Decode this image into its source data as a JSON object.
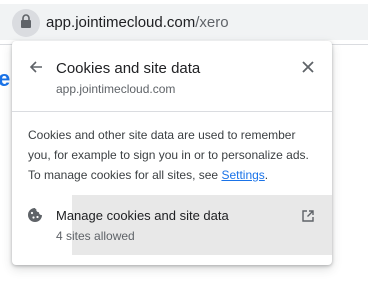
{
  "address_bar": {
    "url_host": "app.jointimecloud.com",
    "url_path": "/xero",
    "lock_icon": "lock-icon"
  },
  "background_page": {
    "partial_text": "e"
  },
  "popup": {
    "title": "Cookies and site data",
    "subtitle": "app.jointimecloud.com",
    "back_icon": "arrow-back-icon",
    "close_icon": "close-icon",
    "description_text": "Cookies and other site data are used to remember you, for example to sign you in or to personalize ads. To manage cookies for all sites, see ",
    "description_link": "Settings",
    "description_end": ".",
    "manage": {
      "label": "Manage cookies and site data",
      "count": "4 sites allowed",
      "icon": "cookie-icon",
      "external_icon": "open-in-new-icon"
    }
  },
  "colors": {
    "link": "#1a73e8",
    "text_primary": "#202124",
    "text_secondary": "#5f6368",
    "divider": "#dadce0"
  }
}
